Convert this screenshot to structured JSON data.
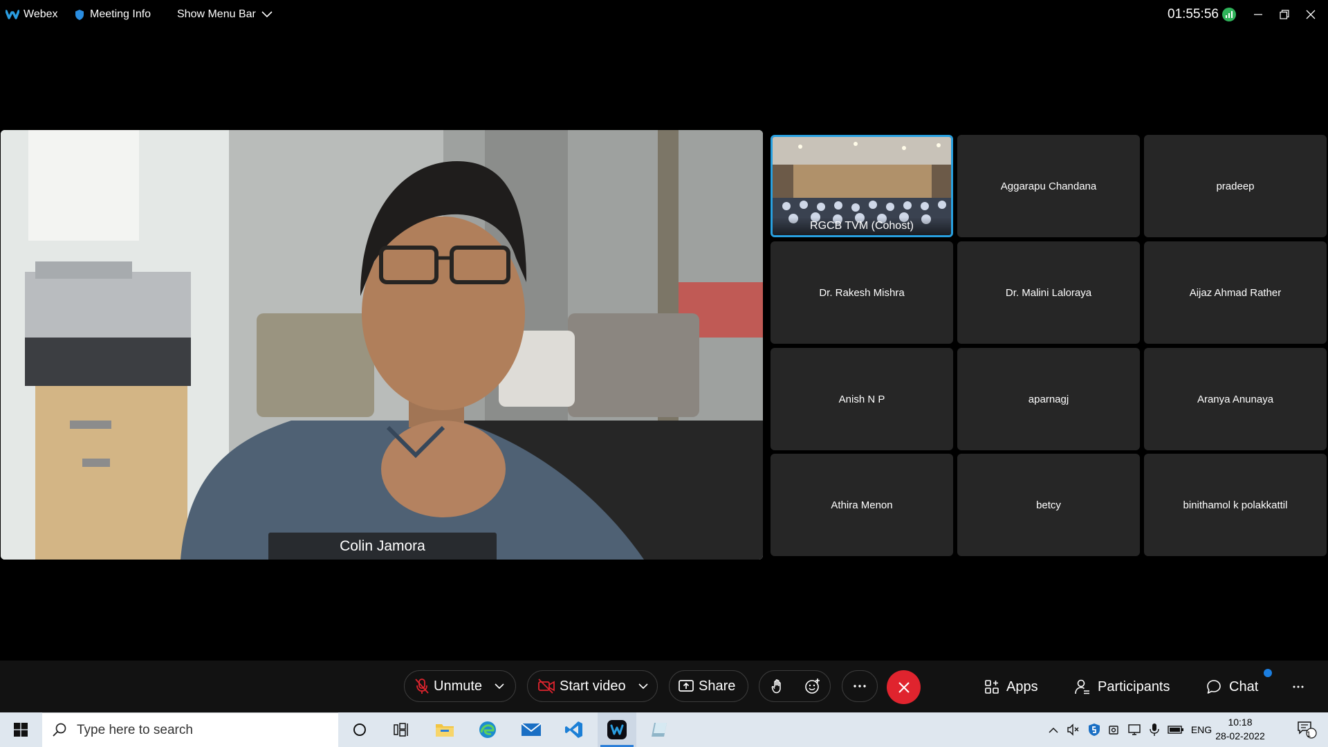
{
  "topbar": {
    "app_name": "Webex",
    "meeting_info": "Meeting Info",
    "show_menu_bar": "Show Menu Bar",
    "elapsed_time": "01:55:56"
  },
  "main_video": {
    "speaker_name": "Colin Jamora"
  },
  "participants": [
    {
      "name": "RGCB TVM  (Cohost)",
      "has_video": true,
      "active": true
    },
    {
      "name": "Aggarapu Chandana"
    },
    {
      "name": "pradeep"
    },
    {
      "name": "Dr. Rakesh Mishra"
    },
    {
      "name": "Dr. Malini Laloraya"
    },
    {
      "name": "Aijaz Ahmad Rather"
    },
    {
      "name": "Anish N P"
    },
    {
      "name": "aparnagj"
    },
    {
      "name": "Aranya Anunaya"
    },
    {
      "name": "Athira Menon"
    },
    {
      "name": "betcy"
    },
    {
      "name": "binithamol k polakkattil"
    }
  ],
  "controls": {
    "unmute": "Unmute",
    "start_video": "Start video",
    "share": "Share",
    "apps": "Apps",
    "participants": "Participants",
    "chat": "Chat"
  },
  "colors": {
    "leave": "#e0242e",
    "active_border": "#28a0e0",
    "tile_bg": "#262626",
    "notification_dot": "#1b7ee0"
  },
  "taskbar": {
    "search_placeholder": "Type here to search",
    "language": "ENG",
    "time": "10:18",
    "date": "28-02-2022",
    "notification_count": "1"
  }
}
